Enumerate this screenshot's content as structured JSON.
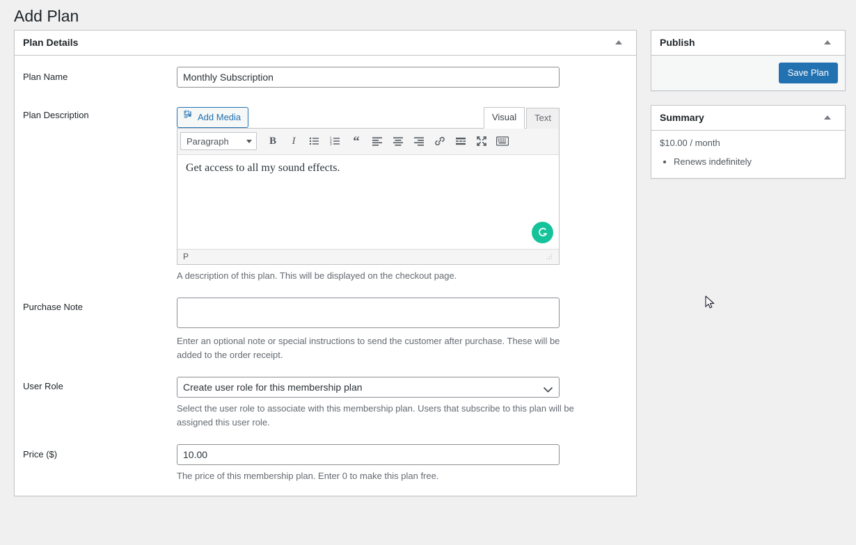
{
  "page": {
    "title": "Add Plan"
  },
  "plan_details": {
    "panel_title": "Plan Details",
    "toggle_icon": "caret-up-icon",
    "fields": {
      "plan_name": {
        "label": "Plan Name",
        "value": "Monthly Subscription",
        "placeholder": ""
      },
      "plan_description": {
        "label": "Plan Description",
        "add_media_label": "Add Media",
        "add_media_icon": "add-media-icon",
        "tabs": [
          {
            "label": "Visual",
            "active": true
          },
          {
            "label": "Text",
            "active": false
          }
        ],
        "format_select": "Paragraph",
        "toolbar_buttons": [
          "bold-icon",
          "italic-icon",
          "bulleted-list-icon",
          "numbered-list-icon",
          "blockquote-icon",
          "align-left-icon",
          "align-center-icon",
          "align-right-icon",
          "link-icon",
          "read-more-icon",
          "fullscreen-icon",
          "toolbar-toggle-icon"
        ],
        "content": "Get access to all my sound effects.",
        "status_path": "P",
        "grammar_indicator": "grammarly-loading-icon",
        "description": "A description of this plan. This will be displayed on the checkout page."
      },
      "purchase_note": {
        "label": "Purchase Note",
        "value": "",
        "placeholder": "",
        "description": "Enter an optional note or special instructions to send the customer after purchase. These will be added to the order receipt."
      },
      "user_role": {
        "label": "User Role",
        "value": "Create user role for this membership plan",
        "options": [
          "Create user role for this membership plan"
        ],
        "description": "Select the user role to associate with this membership plan. Users that subscribe to this plan will be assigned this user role."
      },
      "price": {
        "label": "Price ($)",
        "value": "10.00",
        "placeholder": "",
        "description": "The price of this membership plan. Enter 0 to make this plan free."
      }
    }
  },
  "publish_box": {
    "panel_title": "Publish",
    "toggle_icon": "caret-up-icon",
    "save_label": "Save Plan"
  },
  "summary_box": {
    "panel_title": "Summary",
    "toggle_icon": "caret-up-icon",
    "price_line": "$10.00 / month",
    "items": [
      "Renews indefinitely"
    ]
  },
  "colors": {
    "accent_blue": "#2271b1",
    "page_background": "#f0f0f1",
    "border": "#c3c4c7",
    "grammar_green": "#15c39a"
  }
}
